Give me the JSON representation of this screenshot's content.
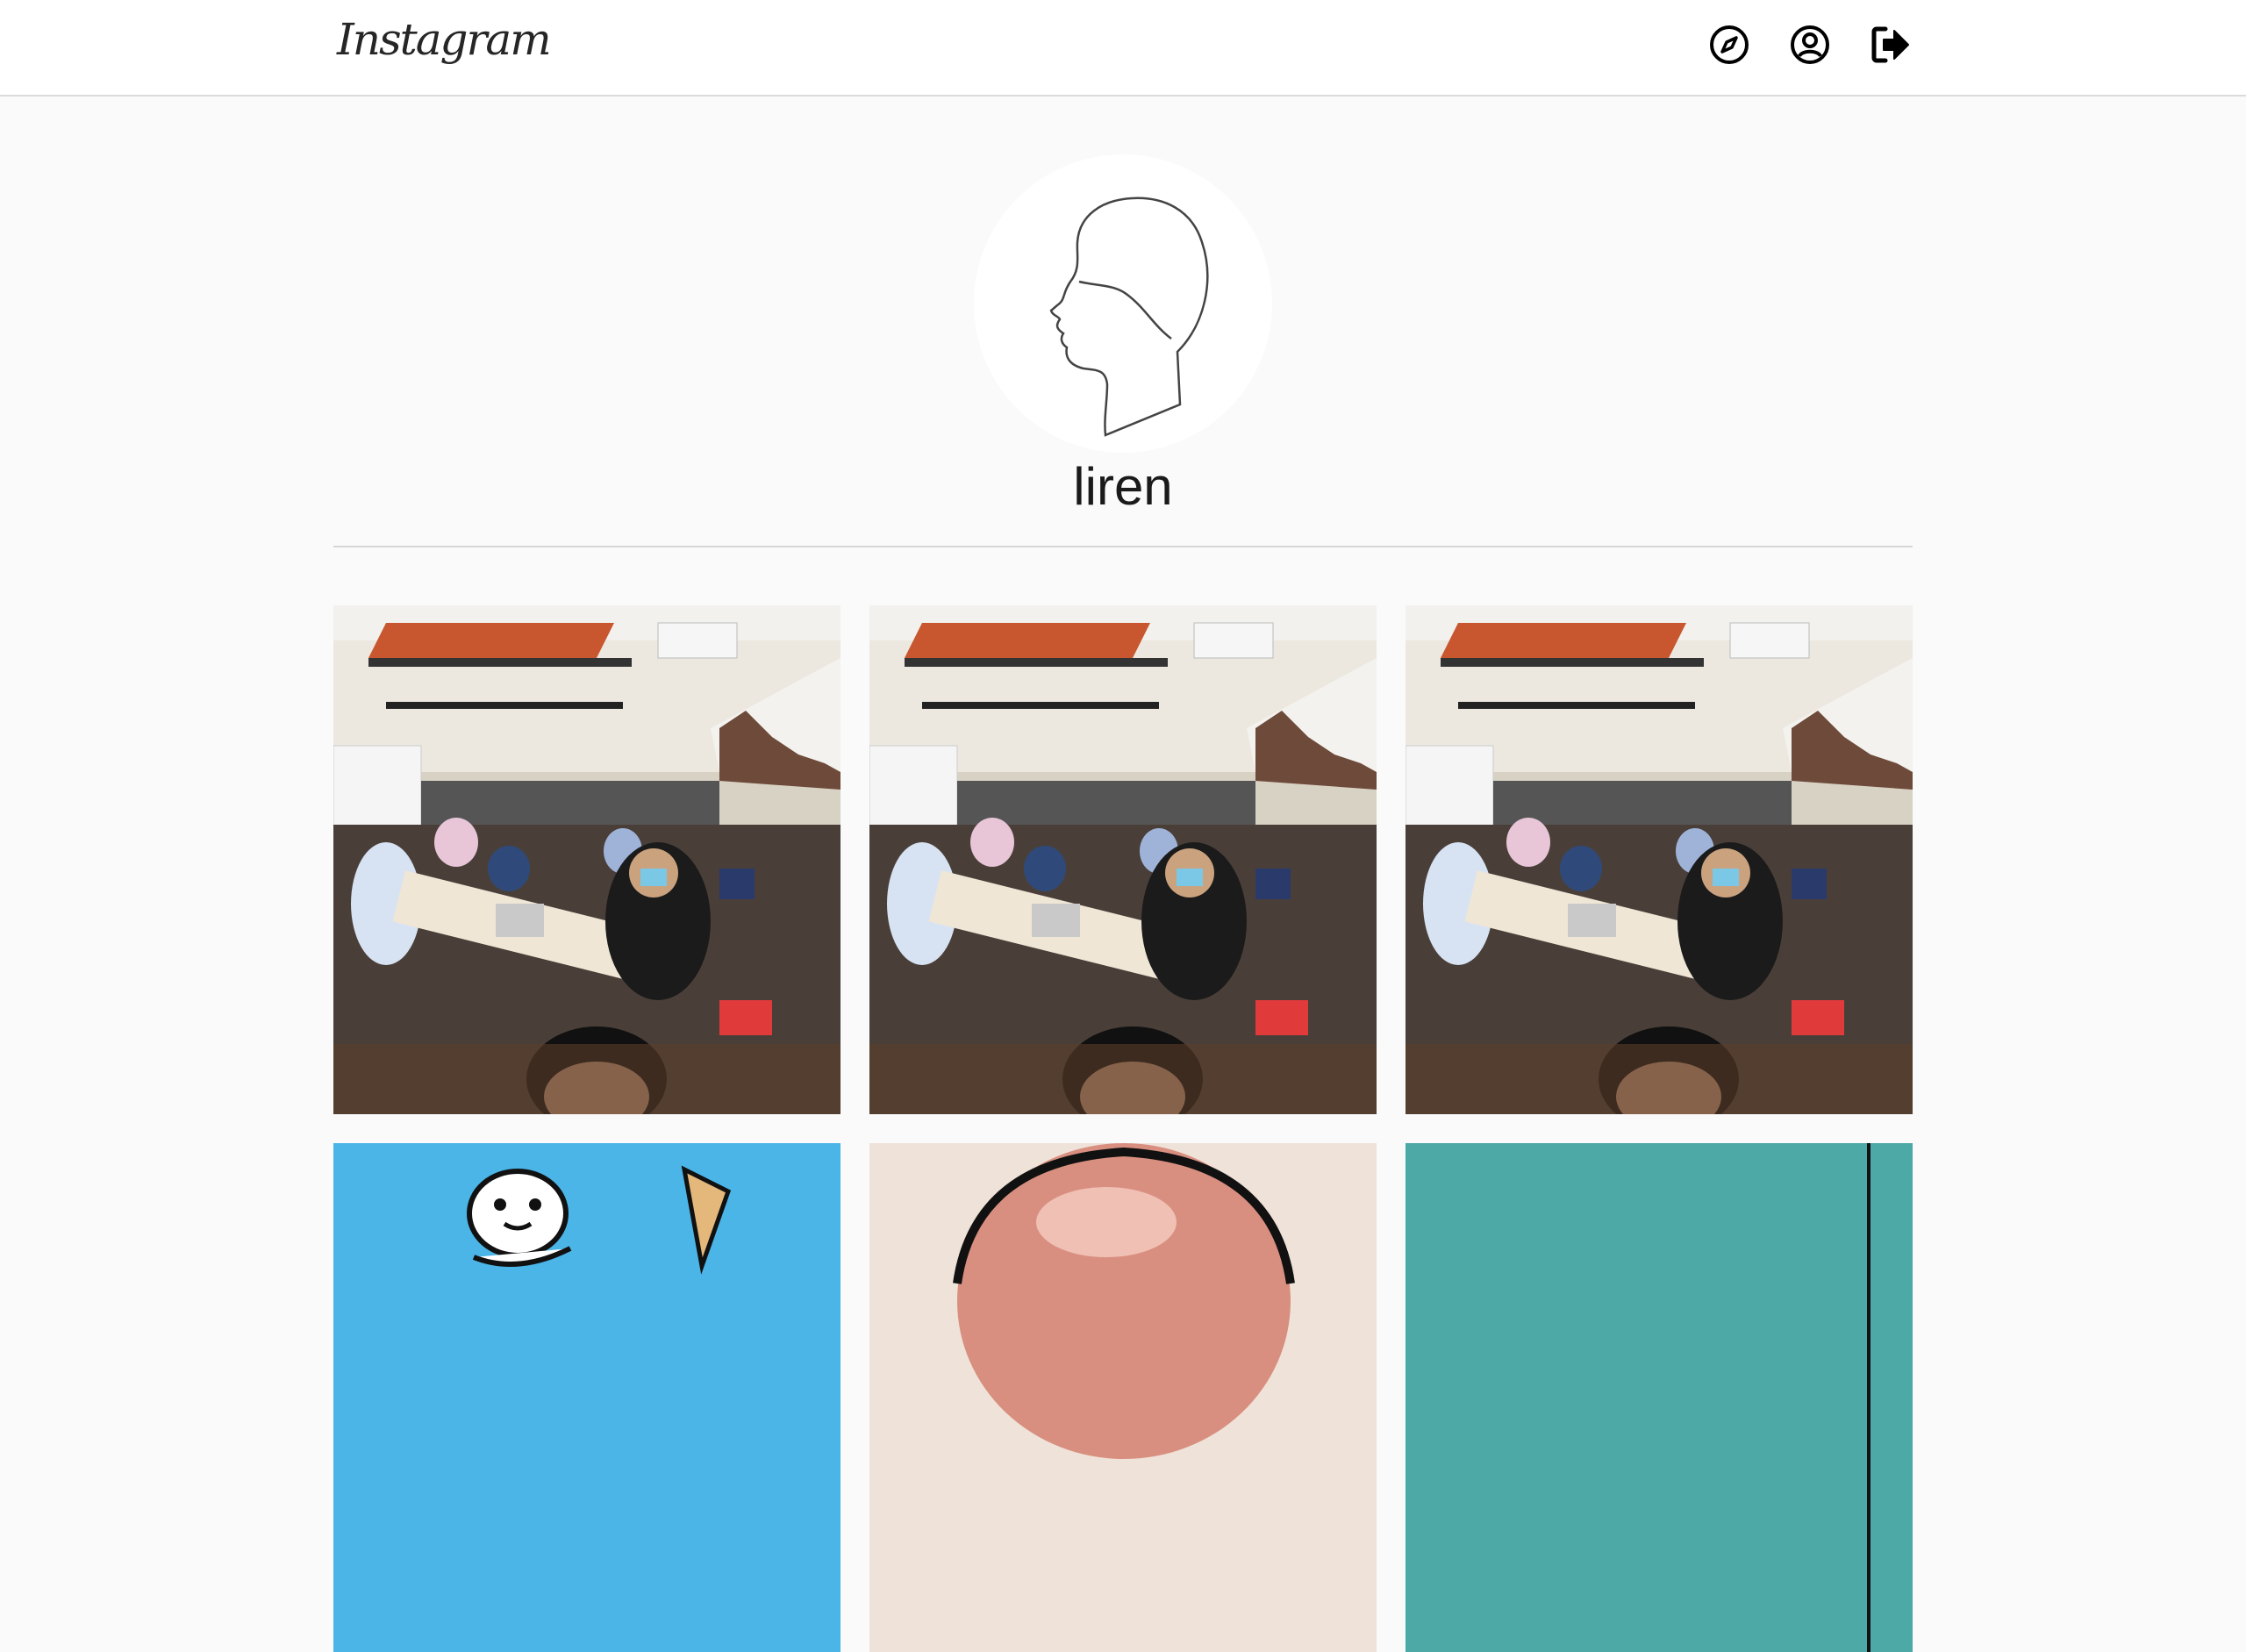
{
  "app": {
    "logo_text": "Instagram"
  },
  "nav": {
    "icons": [
      "compass-icon",
      "user-circle-icon",
      "logout-icon"
    ]
  },
  "profile": {
    "username": "liren",
    "avatar_icon": "profile-silhouette-icon"
  },
  "posts": [
    {
      "type": "classroom-photo"
    },
    {
      "type": "classroom-photo"
    },
    {
      "type": "classroom-photo"
    },
    {
      "type": "cartoon-icecream"
    },
    {
      "type": "bald-head-photo"
    },
    {
      "type": "teal-image"
    }
  ],
  "colors": {
    "header_bg": "#ffffff",
    "page_bg": "#fafafa",
    "text": "#262626",
    "divider": "#dbdbdb"
  }
}
